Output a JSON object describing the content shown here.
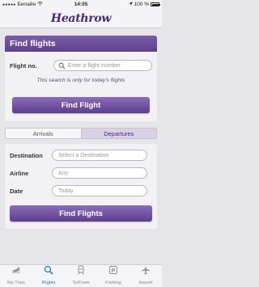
{
  "status_bar": {
    "carrier": "Билайн",
    "time": "14:05",
    "battery": "100 %"
  },
  "header": {
    "logo": "Heathrow"
  },
  "find_flights": {
    "title": "Find flights",
    "flight_no_label": "Flight no.",
    "flight_no_placeholder": "Enter a flight number",
    "note": "This search is only for today's flights",
    "button_label": "Find Flight"
  },
  "toggle": {
    "arrivals": "Arrivals",
    "departures": "Departures",
    "selected": "Departures"
  },
  "search_form": {
    "destination_label": "Destination",
    "destination_placeholder": "Select a Destination",
    "airline_label": "Airline",
    "airline_placeholder": "Any",
    "date_label": "Date",
    "date_placeholder": "Today",
    "button_label": "Find Flights"
  },
  "tabbar": {
    "items": [
      {
        "label": "My Trips",
        "icon": "plane-trips-icon"
      },
      {
        "label": "Flights",
        "icon": "search-icon"
      },
      {
        "label": "To/From",
        "icon": "train-icon"
      },
      {
        "label": "Parking",
        "icon": "parking-icon"
      },
      {
        "label": "Airport",
        "icon": "airplane-icon"
      }
    ],
    "active": "Flights"
  },
  "colors": {
    "brand_purple": "#5e3f8f",
    "active_tab": "#2a7ad6"
  }
}
